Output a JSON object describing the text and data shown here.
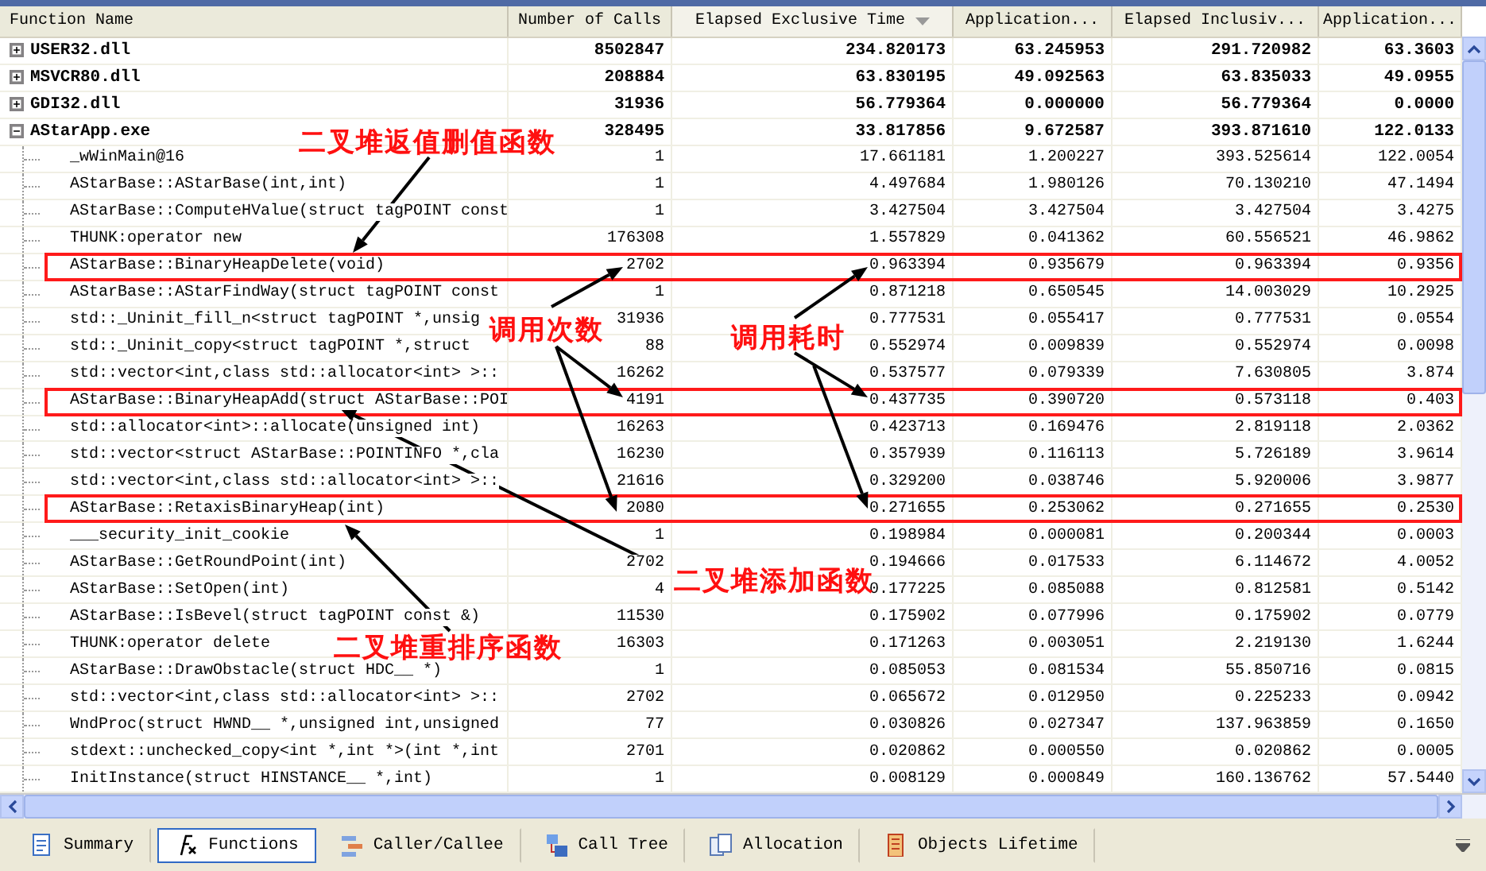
{
  "columns": [
    {
      "label": "Function Name",
      "sorted": false
    },
    {
      "label": "Number of Calls",
      "sorted": false
    },
    {
      "label": "Elapsed Exclusive Time",
      "sorted": true
    },
    {
      "label": "Application...",
      "sorted": false
    },
    {
      "label": "Elapsed Inclusiv...",
      "sorted": false
    },
    {
      "label": "Application...",
      "sorted": false
    }
  ],
  "modules": [
    {
      "name": "USER32.dll",
      "expanded": false,
      "values": [
        "8502847",
        "234.820173",
        "63.245953",
        "291.720982",
        "63.3603"
      ]
    },
    {
      "name": "MSVCR80.dll",
      "expanded": false,
      "values": [
        "208884",
        "63.830195",
        "49.092563",
        "63.835033",
        "49.0955"
      ]
    },
    {
      "name": "GDI32.dll",
      "expanded": false,
      "values": [
        "31936",
        "56.779364",
        "0.000000",
        "56.779364",
        "0.0000"
      ]
    },
    {
      "name": "AStarApp.exe",
      "expanded": true,
      "values": [
        "328495",
        "33.817856",
        "9.672587",
        "393.871610",
        "122.0133"
      ],
      "children": [
        {
          "name": "_wWinMain@16",
          "highlighted": false,
          "values": [
            "1",
            "17.661181",
            "1.200227",
            "393.525614",
            "122.0054"
          ]
        },
        {
          "name": "AStarBase::AStarBase(int,int)",
          "highlighted": false,
          "values": [
            "1",
            "4.497684",
            "1.980126",
            "70.130210",
            "47.1494"
          ]
        },
        {
          "name": "AStarBase::ComputeHValue(struct tagPOINT const",
          "highlighted": false,
          "values": [
            "1",
            "3.427504",
            "3.427504",
            "3.427504",
            "3.4275"
          ]
        },
        {
          "name": "THUNK:operator new",
          "highlighted": false,
          "values": [
            "176308",
            "1.557829",
            "0.041362",
            "60.556521",
            "46.9862"
          ]
        },
        {
          "name": "AStarBase::BinaryHeapDelete(void)",
          "highlighted": true,
          "values": [
            "2702",
            "0.963394",
            "0.935679",
            "0.963394",
            "0.9356"
          ]
        },
        {
          "name": "AStarBase::AStarFindWay(struct tagPOINT const",
          "highlighted": false,
          "values": [
            "1",
            "0.871218",
            "0.650545",
            "14.003029",
            "10.2925"
          ]
        },
        {
          "name": "std::_Uninit_fill_n<struct tagPOINT *,unsig",
          "highlighted": false,
          "values": [
            "31936",
            "0.777531",
            "0.055417",
            "0.777531",
            "0.0554"
          ]
        },
        {
          "name": "std::_Uninit_copy<struct tagPOINT *,struct",
          "highlighted": false,
          "values": [
            "88",
            "0.552974",
            "0.009839",
            "0.552974",
            "0.0098"
          ]
        },
        {
          "name": "std::vector<int,class std::allocator<int> >::",
          "highlighted": false,
          "values": [
            "16262",
            "0.537577",
            "0.079339",
            "7.630805",
            "3.874"
          ]
        },
        {
          "name": "AStarBase::BinaryHeapAdd(struct AStarBase::POI",
          "highlighted": true,
          "values": [
            "4191",
            "0.437735",
            "0.390720",
            "0.573118",
            "0.403"
          ]
        },
        {
          "name": "std::allocator<int>::allocate(unsigned int)",
          "highlighted": false,
          "values": [
            "16263",
            "0.423713",
            "0.169476",
            "2.819118",
            "2.0362"
          ]
        },
        {
          "name": "std::vector<struct AStarBase::POINTINFO *,cla",
          "highlighted": false,
          "values": [
            "16230",
            "0.357939",
            "0.116113",
            "5.726189",
            "3.9614"
          ]
        },
        {
          "name": "std::vector<int,class std::allocator<int> >::",
          "highlighted": false,
          "values": [
            "21616",
            "0.329200",
            "0.038746",
            "5.920006",
            "3.9877"
          ]
        },
        {
          "name": "AStarBase::RetaxisBinaryHeap(int)",
          "highlighted": true,
          "values": [
            "2080",
            "0.271655",
            "0.253062",
            "0.271655",
            "0.2530"
          ]
        },
        {
          "name": "___security_init_cookie",
          "highlighted": false,
          "values": [
            "1",
            "0.198984",
            "0.000081",
            "0.200344",
            "0.0003"
          ]
        },
        {
          "name": "AStarBase::GetRoundPoint(int)",
          "highlighted": false,
          "values": [
            "2702",
            "0.194666",
            "0.017533",
            "6.114672",
            "4.0052"
          ]
        },
        {
          "name": "AStarBase::SetOpen(int)",
          "highlighted": false,
          "values": [
            "4",
            "0.177225",
            "0.085088",
            "0.812581",
            "0.5142"
          ]
        },
        {
          "name": "AStarBase::IsBevel(struct tagPOINT const &)",
          "highlighted": false,
          "values": [
            "11530",
            "0.175902",
            "0.077996",
            "0.175902",
            "0.0779"
          ]
        },
        {
          "name": "THUNK:operator delete",
          "highlighted": false,
          "values": [
            "16303",
            "0.171263",
            "0.003051",
            "2.219130",
            "1.6244"
          ]
        },
        {
          "name": "AStarBase::DrawObstacle(struct HDC__ *)",
          "highlighted": false,
          "values": [
            "1",
            "0.085053",
            "0.081534",
            "55.850716",
            "0.0815"
          ]
        },
        {
          "name": "std::vector<int,class std::allocator<int> >::",
          "highlighted": false,
          "values": [
            "2702",
            "0.065672",
            "0.012950",
            "0.225233",
            "0.0942"
          ]
        },
        {
          "name": "WndProc(struct HWND__ *,unsigned int,unsigned",
          "highlighted": false,
          "values": [
            "77",
            "0.030826",
            "0.027347",
            "137.963859",
            "0.1650"
          ]
        },
        {
          "name": "stdext::unchecked_copy<int *,int *>(int *,int",
          "highlighted": false,
          "values": [
            "2701",
            "0.020862",
            "0.000550",
            "0.020862",
            "0.0005"
          ]
        },
        {
          "name": "InitInstance(struct HINSTANCE__ *,int)",
          "highlighted": false,
          "values": [
            "1",
            "0.008129",
            "0.000849",
            "160.136762",
            "57.5440"
          ]
        }
      ]
    }
  ],
  "annotations": [
    "二叉堆返值删值函数",
    "调用次数",
    "调用耗时",
    "二叉堆添加函数",
    "二叉堆重排序函数"
  ],
  "tabs": [
    {
      "label": "Summary",
      "selected": false
    },
    {
      "label": "Functions",
      "selected": true
    },
    {
      "label": "Caller/Callee",
      "selected": false
    },
    {
      "label": "Call Tree",
      "selected": false
    },
    {
      "label": "Allocation",
      "selected": false
    },
    {
      "label": "Objects Lifetime",
      "selected": false
    }
  ]
}
